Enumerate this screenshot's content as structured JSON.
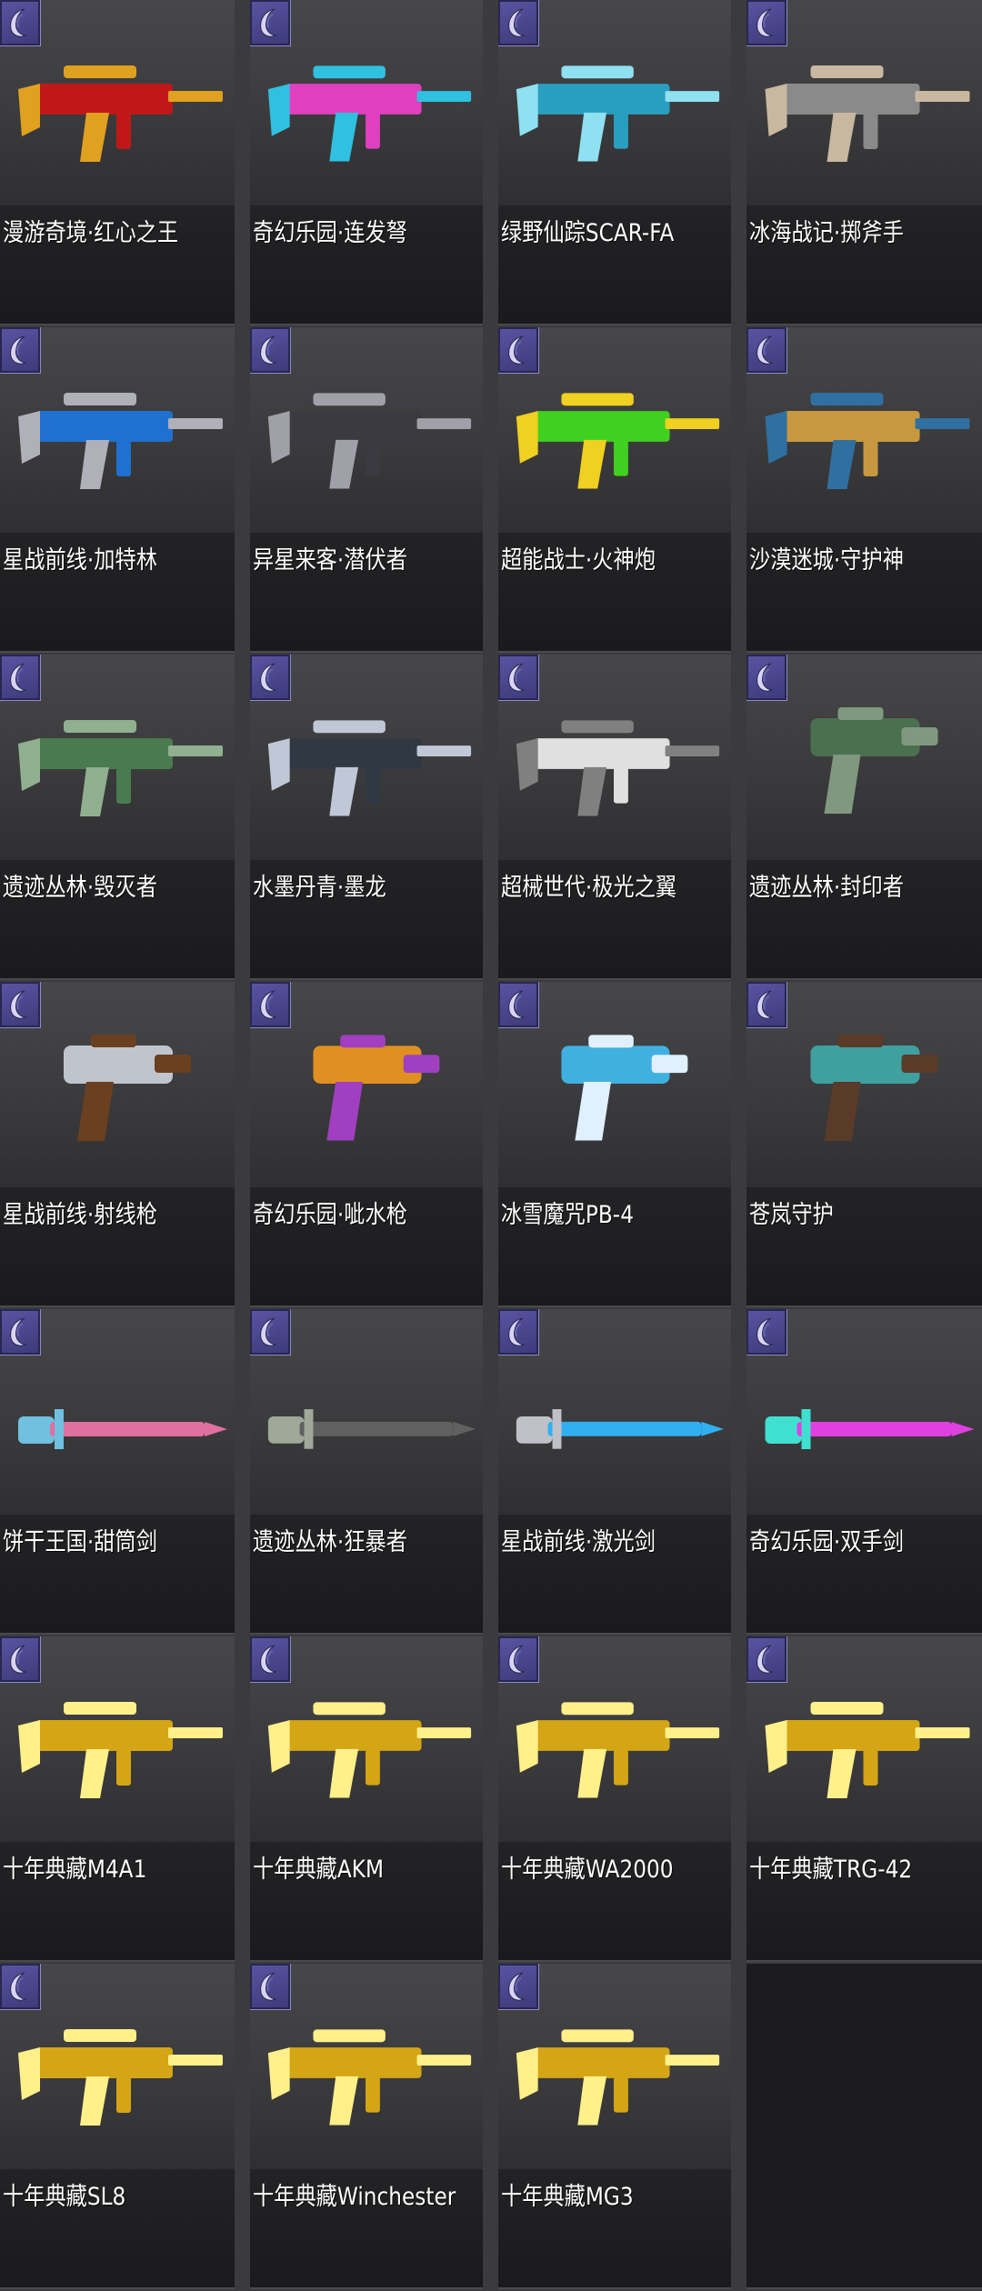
{
  "colors": {
    "page_bg": "#3b3b3d",
    "tile_art_bg": "#404042",
    "tile_label_bg": "#1d1d1f",
    "badge_purple": "#4b4690",
    "label_text": "#ffffff"
  },
  "badge": {
    "icon": "crescent-quality-icon"
  },
  "items": [
    {
      "name": "漫游奇境·红心之王",
      "icon": "ornate-red-gold-rifle-icon",
      "c1": "#c01818",
      "c2": "#e0a020"
    },
    {
      "name": "奇幻乐园·连发弩",
      "icon": "rainbow-crossbow-icon",
      "c1": "#e040c0",
      "c2": "#30c0e0"
    },
    {
      "name": "绿野仙踪SCAR-FA",
      "icon": "teal-assault-rifle-icon",
      "c1": "#2a9ec0",
      "c2": "#8fe0f0"
    },
    {
      "name": "冰海战记·掷斧手",
      "icon": "steel-grenade-launcher-icon",
      "c1": "#8a8a8a",
      "c2": "#c8b8a0"
    },
    {
      "name": "星战前线·加特林",
      "icon": "blue-gatling-gun-icon",
      "c1": "#2070d0",
      "c2": "#b0b0b8"
    },
    {
      "name": "异星来客·潜伏者",
      "icon": "alien-dark-rifle-icon",
      "c1": "#3a3a40",
      "c2": "#a0a0a8"
    },
    {
      "name": "超能战士·火神炮",
      "icon": "green-yellow-cannon-icon",
      "c1": "#40d020",
      "c2": "#f0d020"
    },
    {
      "name": "沙漠迷城·守护神",
      "icon": "egyptian-gold-rifle-icon",
      "c1": "#c89840",
      "c2": "#3070a0"
    },
    {
      "name": "遗迹丛林·毁灭者",
      "icon": "jade-machine-gun-icon",
      "c1": "#4a7a50",
      "c2": "#90b090"
    },
    {
      "name": "水墨丹青·墨龙",
      "icon": "ink-dragon-rifle-icon",
      "c1": "#303844",
      "c2": "#c0c8d8"
    },
    {
      "name": "超械世代·极光之翼",
      "icon": "white-sci-fi-rifle-icon",
      "c1": "#e0e0e0",
      "c2": "#808080"
    },
    {
      "name": "遗迹丛林·封印者",
      "icon": "jade-pistol-icon",
      "c1": "#4a7050",
      "c2": "#809880"
    },
    {
      "name": "星战前线·射线枪",
      "icon": "chrome-ray-gun-icon",
      "c1": "#c0c4cc",
      "c2": "#6a4020"
    },
    {
      "name": "奇幻乐园·呲水枪",
      "icon": "fish-water-gun-icon",
      "c1": "#e09020",
      "c2": "#a040c0"
    },
    {
      "name": "冰雪魔咒PB-4",
      "icon": "ice-dragon-dual-pistols-icon",
      "c1": "#40b0e0",
      "c2": "#e0f0ff"
    },
    {
      "name": "苍岚守护",
      "icon": "teal-dual-pistols-icon",
      "c1": "#40a0a0",
      "c2": "#5a3a28"
    },
    {
      "name": "饼干王国·甜筒剑",
      "icon": "candy-cone-sword-icon",
      "c1": "#e070a0",
      "c2": "#70c0e0"
    },
    {
      "name": "遗迹丛林·狂暴者",
      "icon": "jungle-spear-icon",
      "c1": "#606060",
      "c2": "#a0a898"
    },
    {
      "name": "星战前线·激光剑",
      "icon": "laser-sword-icon",
      "c1": "#30b0f0",
      "c2": "#c0c0c8"
    },
    {
      "name": "奇幻乐园·双手剑",
      "icon": "pink-greatsword-icon",
      "c1": "#e040e0",
      "c2": "#40e0d0"
    },
    {
      "name": "十年典藏M4A1",
      "icon": "gold-m4a1-icon",
      "c1": "#d4a514",
      "c2": "#fff08a"
    },
    {
      "name": "十年典藏AKM",
      "icon": "gold-akm-icon",
      "c1": "#d4a514",
      "c2": "#fff08a"
    },
    {
      "name": "十年典藏WA2000",
      "icon": "gold-wa2000-icon",
      "c1": "#d4a514",
      "c2": "#fff08a"
    },
    {
      "name": "十年典藏TRG-42",
      "icon": "gold-trg42-icon",
      "c1": "#d4a514",
      "c2": "#fff08a"
    },
    {
      "name": "十年典藏SL8",
      "icon": "gold-sl8-icon",
      "c1": "#d4a514",
      "c2": "#fff08a"
    },
    {
      "name": "十年典藏Winchester",
      "icon": "gold-winchester-icon",
      "c1": "#d4a514",
      "c2": "#fff08a"
    },
    {
      "name": "十年典藏MG3",
      "icon": "gold-mg3-icon",
      "c1": "#d4a514",
      "c2": "#fff08a"
    }
  ]
}
